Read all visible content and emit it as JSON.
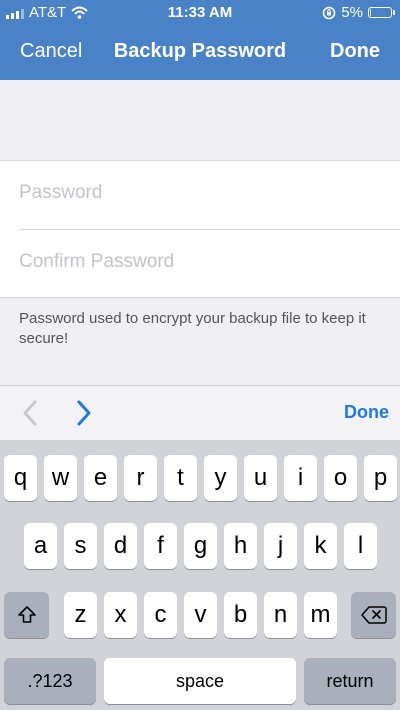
{
  "status_bar": {
    "carrier": "AT&T",
    "time": "11:33 AM",
    "battery_percent": "5%",
    "battery_level": 0.05
  },
  "nav": {
    "cancel": "Cancel",
    "title": "Backup Password",
    "done": "Done"
  },
  "form": {
    "password_placeholder": "Password",
    "confirm_placeholder": "Confirm Password",
    "help": "Password used to encrypt your backup file to keep it secure!"
  },
  "accessory": {
    "done": "Done"
  },
  "keyboard": {
    "row1": [
      "q",
      "w",
      "e",
      "r",
      "t",
      "y",
      "u",
      "i",
      "o",
      "p"
    ],
    "row2": [
      "a",
      "s",
      "d",
      "f",
      "g",
      "h",
      "j",
      "k",
      "l"
    ],
    "row3": [
      "z",
      "x",
      "c",
      "v",
      "b",
      "n",
      "m"
    ],
    "numbers_key": ".?123",
    "space_key": "space",
    "return_key": "return"
  }
}
